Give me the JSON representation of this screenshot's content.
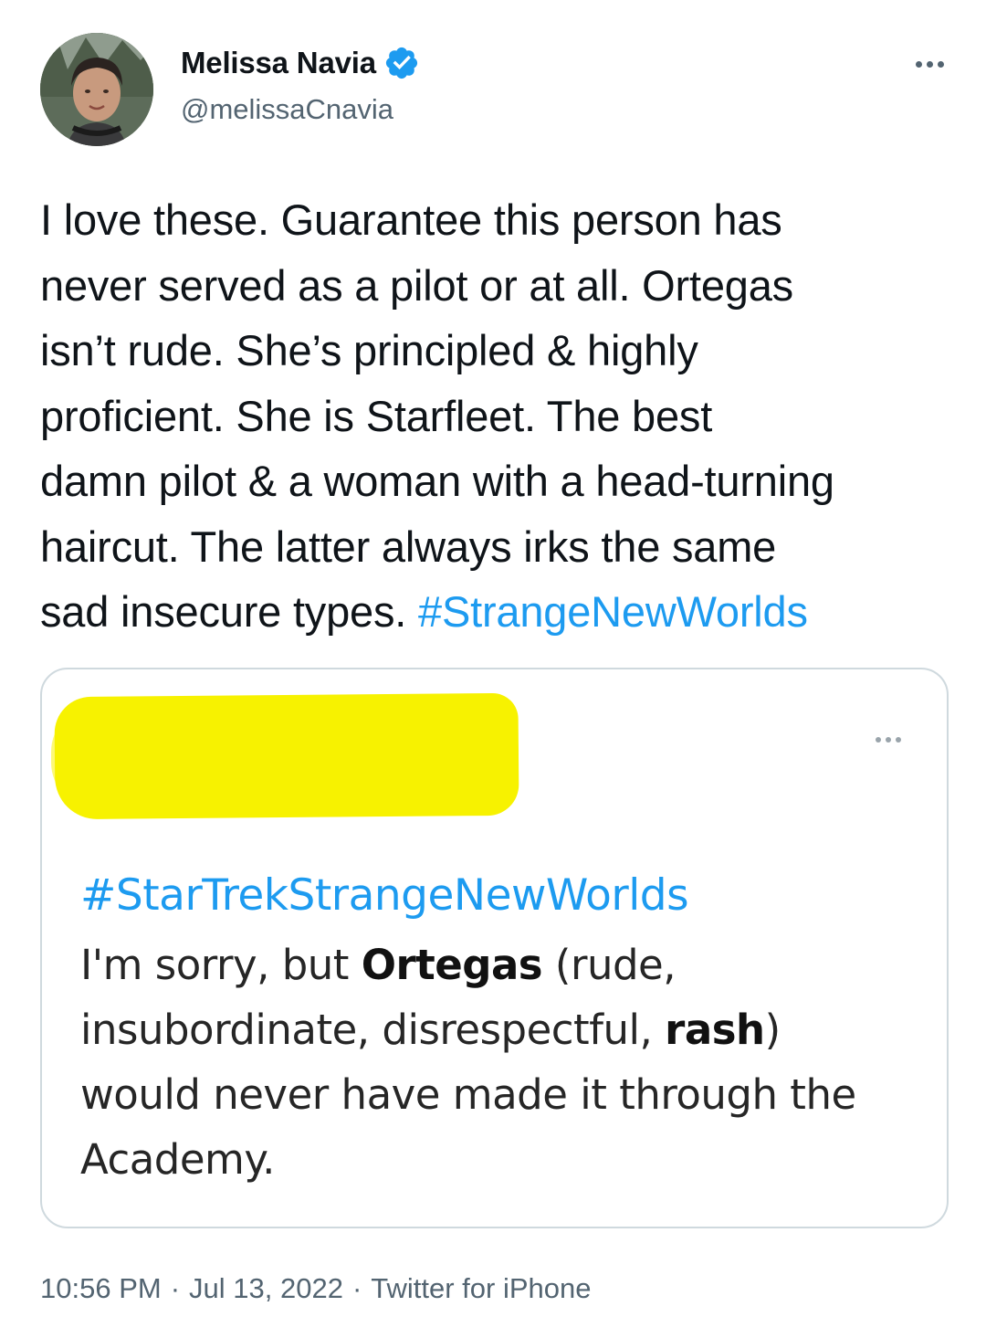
{
  "author": {
    "name": "Melissa Navia",
    "handle": "@melissaCnavia",
    "verified": true
  },
  "tweet": {
    "text_lines": [
      "I love these. Guarantee this person has",
      "never served as a pilot or at all. Ortegas",
      "isn’t rude. She’s principled & highly",
      "proficient. She is Starfleet. The best",
      "damn pilot & a woman with a head-turning",
      "haircut. The latter always irks the same",
      "sad insecure types. "
    ],
    "hashtag": "#StrangeNewWorlds"
  },
  "quoted_image": {
    "hashtag": "#StarTrekStrangeNewWorlds",
    "body_parts": {
      "p1": "I'm sorry, but ",
      "b1": "Ortegas",
      "p2": " (rude,",
      "p3": "insubordinate, disrespectful, ",
      "b2": "rash",
      "p4": ")",
      "p5": "would never have made it through the",
      "p6": "Academy."
    }
  },
  "meta": {
    "time": "10:56 PM",
    "sep1": "·",
    "date": "Jul 13, 2022",
    "sep2": "·",
    "source": "Twitter for iPhone"
  },
  "colors": {
    "link": "#1d9bf0",
    "muted": "#536471",
    "border": "#cfd9de",
    "highlight": "#f7f200"
  },
  "icons": [
    "avatar",
    "verified-badge-icon",
    "more-options-icon",
    "quote-more-options-icon"
  ]
}
